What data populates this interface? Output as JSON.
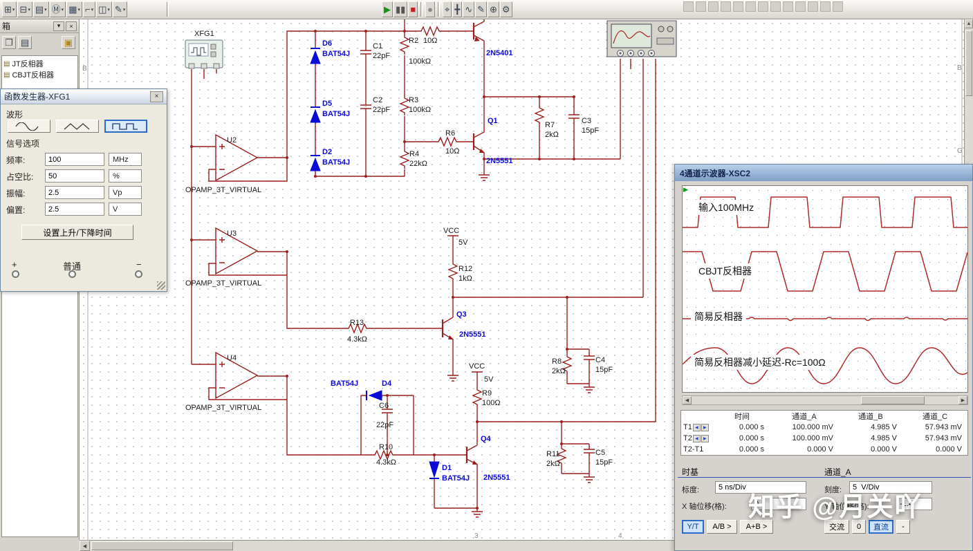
{
  "colors": {
    "wire": "#9b1f1f",
    "label_blue": "#0b0bd6",
    "trace": "#b02a2a",
    "accent_selected": "#2a6cc8"
  },
  "ui_icons": {
    "close": "×",
    "dropdown": "▾",
    "scroll_up": "▲",
    "scroll_down": "▼",
    "scroll_left": "◀",
    "scroll_right": "▶",
    "spin_left": "◀",
    "spin_right": "▶",
    "doc": "▤",
    "folder": "▣",
    "board": "❐",
    "pin": "▾",
    "trigger_arrow": "▶"
  },
  "toolbar": {
    "left_icons": [
      {
        "name": "place-component-icon",
        "glyph": "⊞"
      },
      {
        "name": "place-junction-icon",
        "glyph": "⊟"
      },
      {
        "name": "place-wire-icon",
        "glyph": "▤"
      },
      {
        "name": "multisim-m-icon",
        "glyph": "Ⓜ"
      },
      {
        "name": "place-bus-icon",
        "glyph": "▦"
      },
      {
        "name": "place-connector-icon",
        "glyph": "⌐"
      },
      {
        "name": "place-hierarchical-icon",
        "glyph": "◫"
      },
      {
        "name": "place-text-icon",
        "glyph": "✎"
      }
    ],
    "sim_icons": [
      {
        "name": "run-button",
        "glyph": "▶",
        "color": "#159415"
      },
      {
        "name": "pause-button",
        "glyph": "▮▮",
        "color": "#555"
      },
      {
        "name": "stop-button",
        "glyph": "■",
        "color": "#c22222"
      },
      {
        "name": "record-icon",
        "glyph": "●",
        "color": "#888"
      },
      {
        "name": "probe-icon",
        "glyph": "⌖"
      },
      {
        "name": "measure-icon",
        "glyph": "╋"
      },
      {
        "name": "wave-icon",
        "glyph": "∿"
      },
      {
        "name": "pen-icon",
        "glyph": "✎"
      },
      {
        "name": "zoom-icon",
        "glyph": "⊕"
      },
      {
        "name": "settings-icon",
        "glyph": "⚙"
      }
    ],
    "right_disabled_count": 13
  },
  "toolbox": {
    "title": "箱",
    "items": [
      {
        "label": "JT反相器"
      },
      {
        "label": "CBJT反相器"
      }
    ]
  },
  "fg": {
    "title": "函数发生器-XFG1",
    "waveform_label": "波形",
    "signal_label": "信号选项",
    "rows": [
      {
        "label": "频率:",
        "value": "100",
        "unit": "MHz"
      },
      {
        "label": "占空比:",
        "value": "50",
        "unit": "%"
      },
      {
        "label": "振幅:",
        "value": "2.5",
        "unit": "Vp"
      },
      {
        "label": "偏置:",
        "value": "2.5",
        "unit": "V"
      }
    ],
    "risefall_button": "设置上升/下降时间",
    "terminals": {
      "plus": "+",
      "common": "普通",
      "minus": "−"
    }
  },
  "circuit": {
    "labels": [
      [
        "XFG1",
        281,
        52,
        "k"
      ],
      [
        "D6",
        466,
        66,
        "b"
      ],
      [
        "BAT54J",
        466,
        81,
        "b"
      ],
      [
        "C1",
        539,
        70,
        "k"
      ],
      [
        "22pF",
        539,
        84,
        "k"
      ],
      [
        "R2",
        591,
        62,
        "k"
      ],
      [
        "100kΩ",
        591,
        92,
        "k"
      ],
      [
        "10Ω",
        612,
        62,
        "k"
      ],
      [
        "2N5401",
        703,
        80,
        "b"
      ],
      [
        "D5",
        466,
        153,
        "b"
      ],
      [
        "BAT54J",
        466,
        168,
        "b"
      ],
      [
        "C2",
        539,
        148,
        "k"
      ],
      [
        "22pF",
        539,
        162,
        "k"
      ],
      [
        "R3",
        591,
        148,
        "k"
      ],
      [
        "100kΩ",
        591,
        162,
        "k"
      ],
      [
        "R6",
        644,
        196,
        "k"
      ],
      [
        "10Ω",
        644,
        222,
        "k"
      ],
      [
        "Q1",
        705,
        178,
        "b"
      ],
      [
        "2N5551",
        703,
        236,
        "b"
      ],
      [
        "D2",
        466,
        223,
        "b"
      ],
      [
        "BAT54J",
        466,
        238,
        "b"
      ],
      [
        "R4",
        592,
        226,
        "k"
      ],
      [
        "22kΩ",
        592,
        240,
        "k"
      ],
      [
        "R7",
        788,
        184,
        "k"
      ],
      [
        "2kΩ",
        788,
        198,
        "k"
      ],
      [
        "C3",
        841,
        178,
        "k"
      ],
      [
        "15pF",
        841,
        192,
        "k"
      ],
      [
        "U2",
        328,
        206,
        "k"
      ],
      [
        "OPAMP_3T_VIRTUAL",
        268,
        278,
        "k"
      ],
      [
        "U3",
        328,
        341,
        "k"
      ],
      [
        "OPAMP_3T_VIRTUAL",
        268,
        413,
        "k"
      ],
      [
        "U4",
        328,
        521,
        "k"
      ],
      [
        "OPAMP_3T_VIRTUAL",
        268,
        593,
        "k"
      ],
      [
        "VCC",
        641,
        337,
        "k"
      ],
      [
        "5V",
        663,
        354,
        "k"
      ],
      [
        "R12",
        663,
        392,
        "k"
      ],
      [
        "1kΩ",
        663,
        406,
        "k"
      ],
      [
        "R13",
        506,
        470,
        "k"
      ],
      [
        "4.3kΩ",
        502,
        494,
        "k"
      ],
      [
        "Q3",
        660,
        458,
        "b"
      ],
      [
        "2N5551",
        664,
        487,
        "b"
      ],
      [
        "VCC",
        678,
        533,
        "k"
      ],
      [
        "5V",
        700,
        552,
        "k"
      ],
      [
        "R9",
        697,
        572,
        "k"
      ],
      [
        "100Ω",
        697,
        586,
        "k"
      ],
      [
        "R8",
        798,
        526,
        "k"
      ],
      [
        "2kΩ",
        798,
        540,
        "k"
      ],
      [
        "C4",
        861,
        524,
        "k"
      ],
      [
        "15pF",
        861,
        538,
        "k"
      ],
      [
        "BAT54J",
        478,
        558,
        "b"
      ],
      [
        "D4",
        552,
        558,
        "b"
      ],
      [
        "C6",
        548,
        590,
        "k"
      ],
      [
        "22pF",
        544,
        618,
        "k"
      ],
      [
        "R10",
        548,
        650,
        "k"
      ],
      [
        "4.3kΩ",
        544,
        672,
        "k"
      ],
      [
        "Q4",
        695,
        638,
        "b"
      ],
      [
        "2N5551",
        699,
        694,
        "b"
      ],
      [
        "D1",
        639,
        680,
        "b"
      ],
      [
        "BAT54J",
        639,
        695,
        "b"
      ],
      [
        "R11",
        790,
        660,
        "k"
      ],
      [
        "2kΩ",
        790,
        674,
        "k"
      ],
      [
        "C5",
        861,
        658,
        "k"
      ],
      [
        "15pF",
        861,
        672,
        "k"
      ]
    ],
    "sheet_marks": [
      [
        "B",
        119,
        102
      ],
      [
        "B",
        1384,
        101
      ],
      [
        "G",
        1384,
        221
      ],
      [
        "3",
        686,
        778
      ],
      [
        "4",
        894,
        778
      ]
    ]
  },
  "scope": {
    "title": "4通道示波器-XSC2",
    "trace_labels": [
      "输入100MHz",
      "CBJT反相器",
      "简易反相器",
      "简易反相器减小延迟-Rc=100Ω"
    ],
    "table": {
      "headers": [
        "时间",
        "通道_A",
        "通道_B",
        "通道_C"
      ],
      "rows": [
        {
          "name": "T1",
          "values": [
            "0.000 s",
            "100.000 mV",
            "4.985 V",
            "57.943 mV"
          ]
        },
        {
          "name": "T2",
          "values": [
            "0.000 s",
            "100.000 mV",
            "4.985 V",
            "57.943 mV"
          ]
        },
        {
          "name": "T2-T1",
          "values": [
            "0.000 s",
            "0.000 V",
            "0.000 V",
            "0.000 V"
          ]
        }
      ]
    },
    "timebase": {
      "title": "时基",
      "scale_label": "标度:",
      "scale": "5 ns/Div",
      "offset_label": "X 轴位移(格):",
      "offset": "0",
      "mode_buttons": [
        "Y/T",
        "A/B >",
        "A+B >"
      ]
    },
    "channel": {
      "title": "通道_A",
      "scale_label": "刻度:",
      "scale": "5  V/Div",
      "offset_label": "Y 轴位移(格):",
      "offset": "-1.4",
      "coupling_buttons": [
        "交流",
        "0",
        "直流",
        "-"
      ]
    }
  },
  "watermark": "知乎 @月关吖"
}
